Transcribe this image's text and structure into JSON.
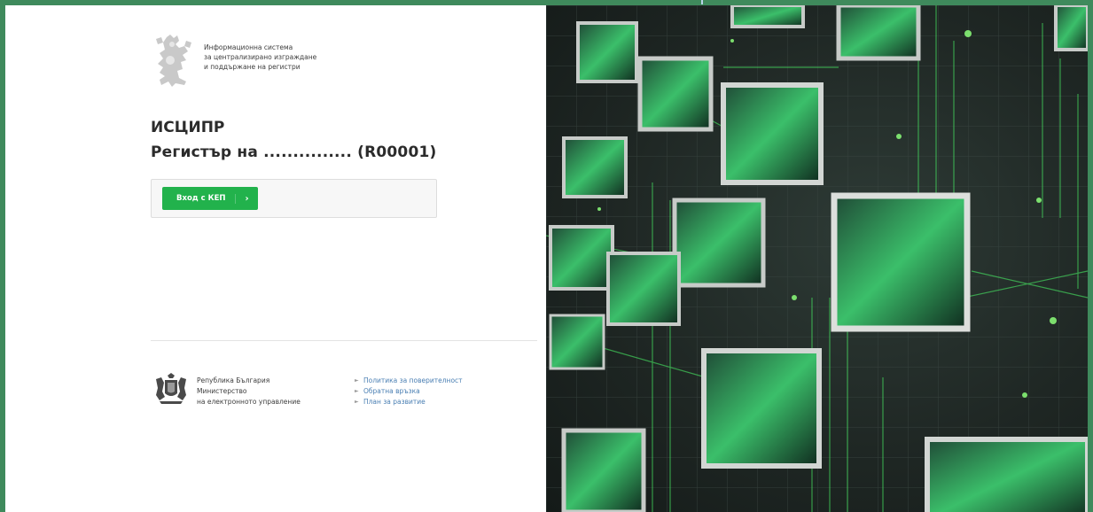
{
  "header": {
    "logo_lines": [
      "Информационна система",
      "за централизирано изграждане",
      "и поддържане на регистри"
    ]
  },
  "main": {
    "system_title": "ИСЦИПР",
    "register_title": "Регистър на ............... (R00001)",
    "login_button_label": "Вход с КЕП",
    "login_button_arrow": "›"
  },
  "footer": {
    "ministry_lines": [
      "Република България",
      "Министерство",
      "на електронното управление"
    ],
    "links": [
      "Политика за поверителност",
      "Обратна връзка",
      "План за развитие"
    ],
    "link_bullet": "►"
  },
  "colors": {
    "accent_green": "#22b24c",
    "frame_green": "#3f8a5c",
    "link_blue": "#4a7fb3"
  },
  "icons": {
    "header_emblem": "lion-emblem-icon",
    "footer_emblem": "coat-of-arms-icon"
  }
}
